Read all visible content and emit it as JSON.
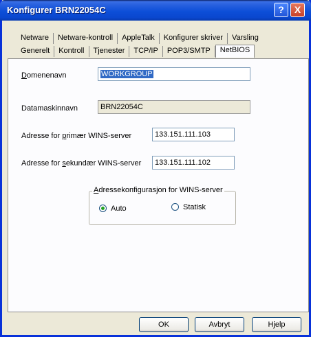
{
  "window": {
    "title": "Konfigurer BRN22054C"
  },
  "titlebar": {
    "help_glyph": "?",
    "close_glyph": "X"
  },
  "tabs_back": [
    "Netware",
    "Netware-kontroll",
    "AppleTalk",
    "Konfigurer skriver",
    "Varsling"
  ],
  "tabs_front": [
    "Generelt",
    "Kontroll",
    "Tjenester",
    "TCP/IP",
    "POP3/SMTP",
    "NetBIOS"
  ],
  "selected_tab": "NetBIOS",
  "form": {
    "domain": {
      "label_pre": "",
      "label_ul": "D",
      "label_post": "omenenavn",
      "value": "WORKGROUP"
    },
    "computer": {
      "label": "Datamaskinnavn",
      "value": "BRN22054C"
    },
    "primary_wins": {
      "label_pre": "Adresse for ",
      "label_ul": "p",
      "label_post": "rimær WINS-server",
      "value": "133.151.111.103"
    },
    "secondary_wins": {
      "label_pre": "Adresse for ",
      "label_ul": "s",
      "label_post": "ekundær WINS-server",
      "value": "133.151.111.102"
    }
  },
  "wins_config": {
    "legend_ul": "A",
    "legend_post": "dressekonfigurasjon for WINS-server",
    "options": [
      {
        "label": "Auto",
        "selected": true
      },
      {
        "label": "Statisk",
        "selected": false
      }
    ]
  },
  "buttons": {
    "ok": "OK",
    "cancel": "Avbryt",
    "help": "Hjelp"
  }
}
